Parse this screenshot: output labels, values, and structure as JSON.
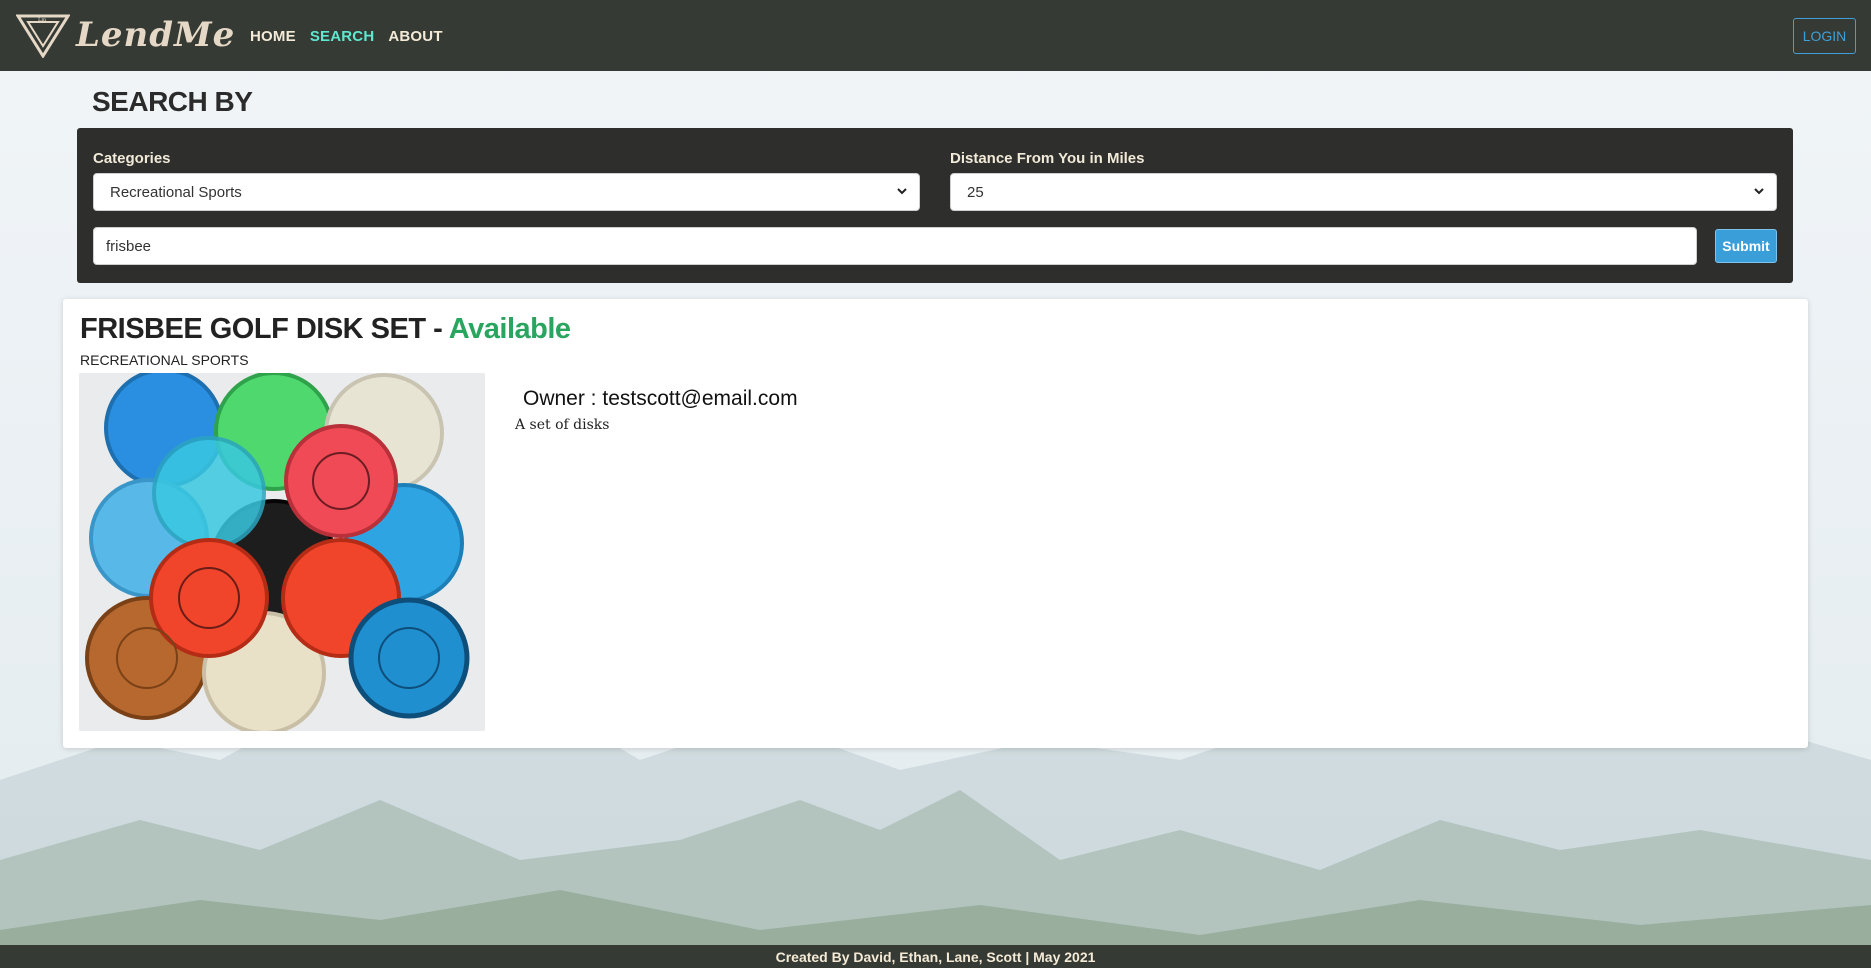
{
  "brand": {
    "name": "LendMe",
    "logo_icon": "triangle-logo-icon"
  },
  "nav": {
    "items": [
      {
        "label": "HOME",
        "active": false
      },
      {
        "label": "SEARCH",
        "active": true
      },
      {
        "label": "ABOUT",
        "active": false
      }
    ],
    "login_label": "LOGIN"
  },
  "search": {
    "heading": "SEARCH BY",
    "category_label": "Categories",
    "category_value": "Recreational Sports",
    "distance_label": "Distance From You in Miles",
    "distance_value": "25",
    "query_value": "frisbee",
    "submit_label": "Submit"
  },
  "results": [
    {
      "title": "FRISBEE GOLF DISK SET",
      "separator": " - ",
      "status": "Available",
      "category": "RECREATIONAL SPORTS",
      "owner_prefix": "Owner : ",
      "owner": "testscott@email.com",
      "description": "A set of disks"
    }
  ],
  "footer": {
    "text": "Created By David, Ethan, Lane, Scott | May 2021"
  },
  "colors": {
    "navbar": "#363a34",
    "accent_active": "#5fe8d0",
    "login": "#3fa0d8",
    "available": "#2aa55f",
    "panel": "#2e2e2c",
    "submit": "#3a9ed9"
  }
}
